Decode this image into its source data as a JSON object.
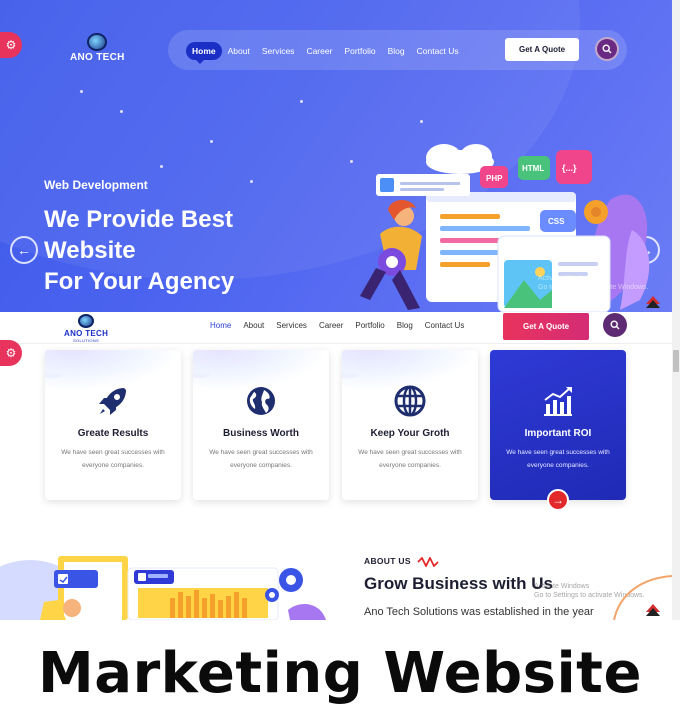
{
  "colors": {
    "hero_start": "#3d5ae9",
    "hero_end": "#6b7cf5",
    "accent_pink": "#e8335d",
    "nav_active": "#1b2fc7",
    "card_dark": "#2f3ad6",
    "search_purple": "#6a2a84",
    "arrow_red": "#e2282a"
  },
  "logo": {
    "text": "ANO TECH",
    "subtext": "SOLUTIONS"
  },
  "hero": {
    "nav": [
      "Home",
      "About",
      "Services",
      "Career",
      "Portfolio",
      "Blog",
      "Contact Us"
    ],
    "active_nav": "Home",
    "quote_label": "Get A Quote",
    "eyebrow": "Web Development",
    "title_line1": "We Provide Best",
    "title_line2": "Website",
    "title_line3": "For Your Agency",
    "prev_icon": "arrow-left-icon",
    "next_icon": "arrow-right-icon",
    "watermark_line1": "Activate Windows",
    "watermark_line2": "Go to Settings to activate Windows."
  },
  "sticky": {
    "nav": [
      "Home",
      "About",
      "Services",
      "Career",
      "Portfolio",
      "Blog",
      "Contact Us"
    ],
    "active_nav": "Home",
    "quote_label": "Get A Quote"
  },
  "features": [
    {
      "icon": "rocket-icon",
      "title": "Greate Results",
      "desc": "We have seen great successes with everyone companies."
    },
    {
      "icon": "globe-icon",
      "title": "Business Worth",
      "desc": "We have seen great successes with everyone companies."
    },
    {
      "icon": "world-icon",
      "title": "Keep Your Groth",
      "desc": "We have seen great successes with everyone companies."
    },
    {
      "icon": "chart-icon",
      "title": "Important ROI",
      "desc": "We have seen great successes with everyone companies."
    }
  ],
  "about": {
    "eyebrow": "ABOUT US",
    "title": "Grow Business with Us",
    "text": "Ano Tech Solutions was established in the year",
    "watermark_line1": "Activate Windows",
    "watermark_line2": "Go to Settings to activate Windows."
  },
  "banner": {
    "text": "Marketing Website"
  }
}
